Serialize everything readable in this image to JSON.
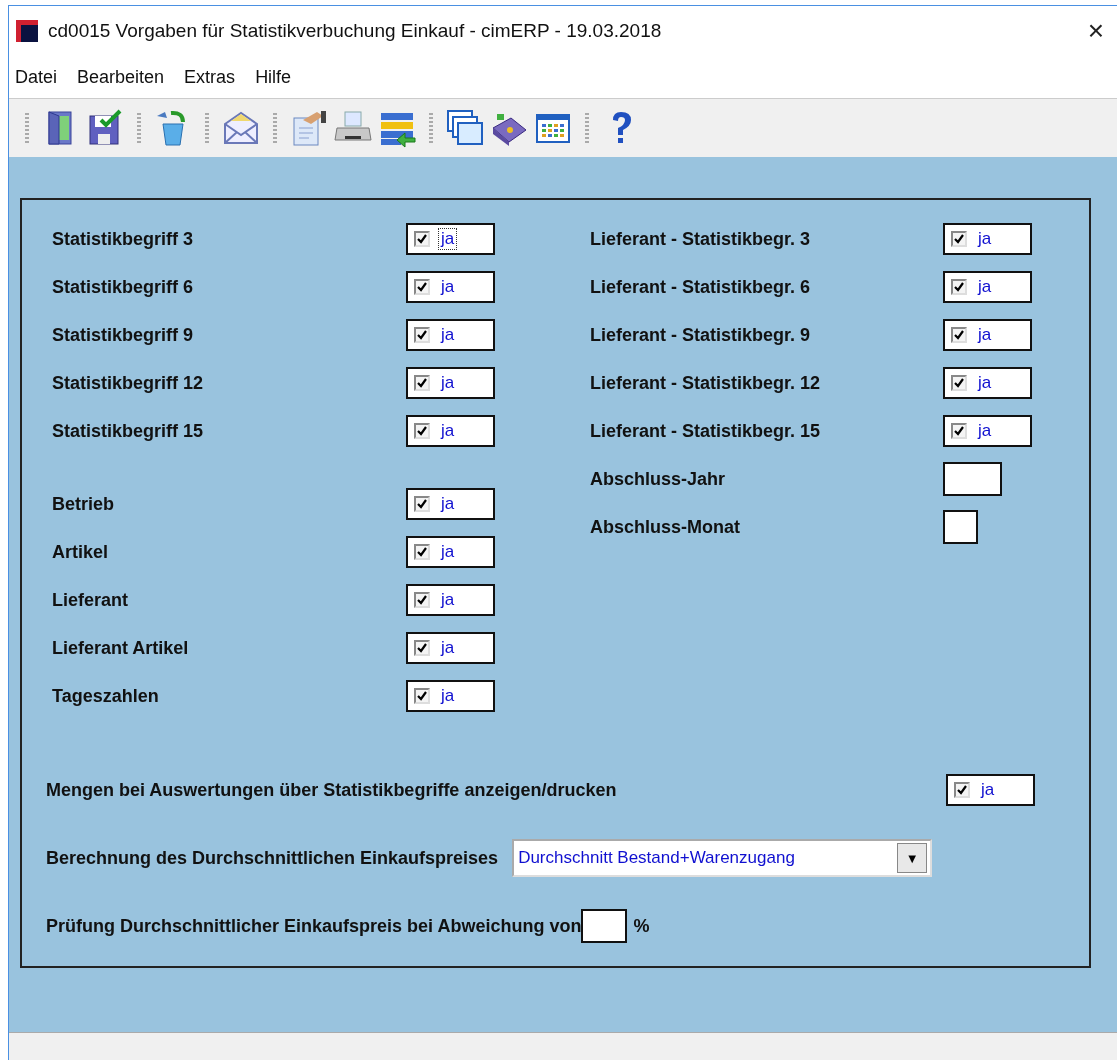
{
  "window": {
    "title": "cd0015 Vorgaben für Statistikverbuchung Einkauf - cimERP - 19.03.2018",
    "close": "×"
  },
  "menu": [
    {
      "label": "Datei"
    },
    {
      "label": "Bearbeiten"
    },
    {
      "label": "Extras"
    },
    {
      "label": "Hilfe"
    }
  ],
  "left_groups": [
    [
      {
        "label": "Statistikbegriff 3",
        "checked": true,
        "value": "ja",
        "focused": true
      },
      {
        "label": "Statistikbegriff 6",
        "checked": true,
        "value": "ja",
        "focused": false
      },
      {
        "label": "Statistikbegriff 9",
        "checked": true,
        "value": "ja",
        "focused": false
      },
      {
        "label": "Statistikbegriff 12",
        "checked": true,
        "value": "ja",
        "focused": false
      },
      {
        "label": "Statistikbegriff 15",
        "checked": true,
        "value": "ja",
        "focused": false
      }
    ],
    [
      {
        "label": "Betrieb",
        "checked": true,
        "value": "ja",
        "focused": false
      },
      {
        "label": "Artikel",
        "checked": true,
        "value": "ja",
        "focused": false
      },
      {
        "label": "Lieferant",
        "checked": true,
        "value": "ja",
        "focused": false
      },
      {
        "label": "Lieferant Artikel",
        "checked": true,
        "value": "ja",
        "focused": false
      },
      {
        "label": "Tageszahlen",
        "checked": true,
        "value": "ja",
        "focused": false
      }
    ]
  ],
  "right_fields": [
    {
      "kind": "checkbox",
      "label": "Lieferant - Statistikbegr. 3",
      "checked": true,
      "value": "ja",
      "focused": false
    },
    {
      "kind": "checkbox",
      "label": "Lieferant - Statistikbegr. 6",
      "checked": true,
      "value": "ja",
      "focused": false
    },
    {
      "kind": "checkbox",
      "label": "Lieferant - Statistikbegr. 9",
      "checked": true,
      "value": "ja",
      "focused": false
    },
    {
      "kind": "checkbox",
      "label": "Lieferant - Statistikbegr. 12",
      "checked": true,
      "value": "ja",
      "focused": false
    },
    {
      "kind": "checkbox",
      "label": "Lieferant - Statistikbegr. 15",
      "checked": true,
      "value": "ja",
      "focused": false
    },
    {
      "kind": "year",
      "label": "Abschluss-Jahr"
    },
    {
      "kind": "month",
      "label": "Abschluss-Monat"
    }
  ],
  "quantities": {
    "label": "Mengen bei Auswertungen über Statistikbegriffe anzeigen/drucken",
    "checked": true,
    "value": "ja",
    "focused": false
  },
  "average_price": {
    "label": "Berechnung des Durchschnittlichen Einkaufspreises",
    "value": "Durchschnitt Bestand+Warenzugang",
    "arrow": "▼"
  },
  "deviation": {
    "label": "Prüfung Durchschnittlicher Einkaufspreis bei Abweichung von",
    "unit": "%"
  }
}
